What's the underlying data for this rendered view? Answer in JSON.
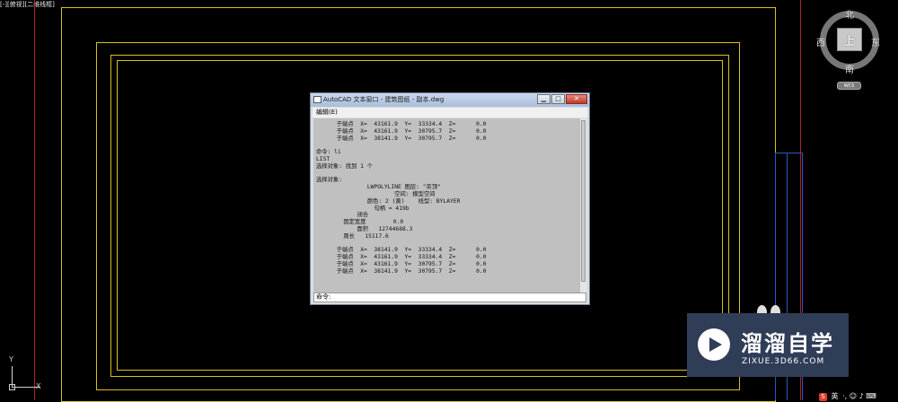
{
  "viewport": {
    "label": "[-][俯视][二维线框]"
  },
  "viewcube": {
    "face": "上",
    "north": "北",
    "south": "南",
    "east": "东",
    "west": "西",
    "wcs": "WCS"
  },
  "text_window": {
    "title": "AutoCAD 文本窗口 - 建筑图纸 - 副本.dwg",
    "menu": [
      "编辑(E)"
    ],
    "lines": [
      "      于端点  X=  43161.9  Y=  33334.4  Z=      0.0",
      "      于端点  X=  43161.9  Y=  30795.7  Z=      0.0",
      "      于端点  X=  38141.9  Y=  30795.7  Z=      0.0",
      "",
      "命令: li",
      "LIST",
      "选择对象: 找到 1 个",
      "",
      "选择对象:",
      "               LWPOLYLINE 图层: \"吊顶\"",
      "                       空间: 模型空间",
      "               颜色: 2 (黄)    线型: BYLAYER",
      "                 句柄 = 419b",
      "            闭合",
      "        固定宽度        0.0",
      "            面积   12744688.3",
      "        周长   15117.6",
      "",
      "      于端点  X=  38141.9  Y=  33334.4  Z=      0.0",
      "      于端点  X=  43161.9  Y=  33334.4  Z=      0.0",
      "      于端点  X=  43161.9  Y=  30795.7  Z=      0.0",
      "      于端点  X=  38141.9  Y=  30795.7  Z=      0.0"
    ],
    "command_prompt": "命令:",
    "buttons": {
      "minimize": "▁",
      "maximize": "□",
      "close": "✕"
    }
  },
  "ucs": {
    "x": "X",
    "y": "Y"
  },
  "watermark": {
    "title": "溜溜自学",
    "subtitle": "ZIXUE.3D66.COM"
  },
  "ime": {
    "s_logo": "S",
    "lang": "英",
    "icons": "·, ☺ ♪ ⌨"
  },
  "colors": {
    "drawing_line": "#d7c21a",
    "background": "#000000",
    "watermark_bg": "#2f3d57"
  }
}
